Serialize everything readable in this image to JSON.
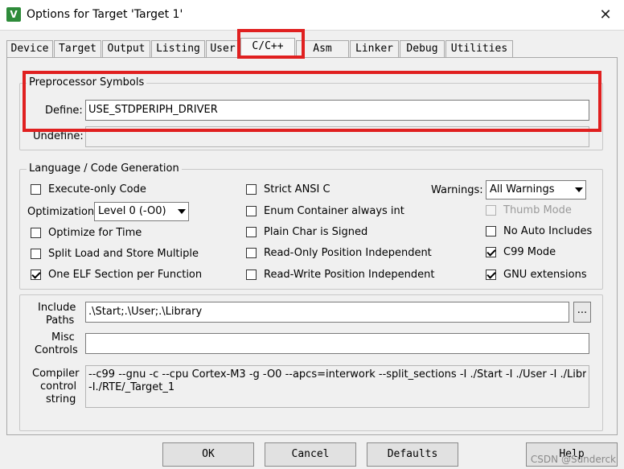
{
  "window": {
    "title": "Options for Target 'Target 1'",
    "app_icon": "V",
    "close": "✕"
  },
  "tabs": [
    {
      "label": "Device"
    },
    {
      "label": "Target"
    },
    {
      "label": "Output"
    },
    {
      "label": "Listing"
    },
    {
      "label": "User"
    },
    {
      "label": "C/C++"
    },
    {
      "label": "Asm"
    },
    {
      "label": "Linker"
    },
    {
      "label": "Debug"
    },
    {
      "label": "Utilities"
    }
  ],
  "active_tab": "C/C++",
  "highlight_color": "#e02020",
  "preprocessor": {
    "title": "Preprocessor Symbols",
    "define_label": "Define:",
    "define_value": "USE_STDPERIPH_DRIVER",
    "undefine_label": "Undefine:",
    "undefine_value": ""
  },
  "codegen": {
    "title": "Language / Code Generation",
    "execute_only": {
      "label": "Execute-only Code",
      "checked": false
    },
    "optimization_label": "Optimization:",
    "optimization_value": "Level 0 (-O0)",
    "optimize_time": {
      "label": "Optimize for Time",
      "checked": false
    },
    "split_load": {
      "label": "Split Load and Store Multiple",
      "checked": false
    },
    "one_elf": {
      "label": "One ELF Section per Function",
      "checked": true
    },
    "strict_ansi": {
      "label": "Strict ANSI C",
      "checked": false
    },
    "enum_container": {
      "label": "Enum Container always int",
      "checked": false
    },
    "plain_char": {
      "label": "Plain Char is Signed",
      "checked": false
    },
    "ropi": {
      "label": "Read-Only Position Independent",
      "checked": false
    },
    "rwpi": {
      "label": "Read-Write Position Independent",
      "checked": false
    },
    "warnings_label": "Warnings:",
    "warnings_value": "All Warnings",
    "thumb_mode": {
      "label": "Thumb Mode",
      "checked": false,
      "disabled": true
    },
    "no_auto_includes": {
      "label": "No Auto Includes",
      "checked": false
    },
    "c99": {
      "label": "C99 Mode",
      "checked": true
    },
    "gnu_ext": {
      "label": "GNU extensions",
      "checked": true
    }
  },
  "include": {
    "label_line1": "Include",
    "label_line2": "Paths",
    "value": ".\\Start;.\\User;.\\Library",
    "browse": "..."
  },
  "misc": {
    "label_line1": "Misc",
    "label_line2": "Controls",
    "value": ""
  },
  "compiler": {
    "label_line1": "Compiler",
    "label_line2": "control",
    "label_line3": "string",
    "line1": "--c99 --gnu -c --cpu Cortex-M3 -g -O0 --apcs=interwork --split_sections -I ./Start -I ./User -I ./Library",
    "line2": "-I./RTE/_Target_1"
  },
  "buttons": {
    "ok": "OK",
    "cancel": "Cancel",
    "defaults": "Defaults",
    "help": "Help"
  },
  "watermark": "CSDN @Sunderck"
}
